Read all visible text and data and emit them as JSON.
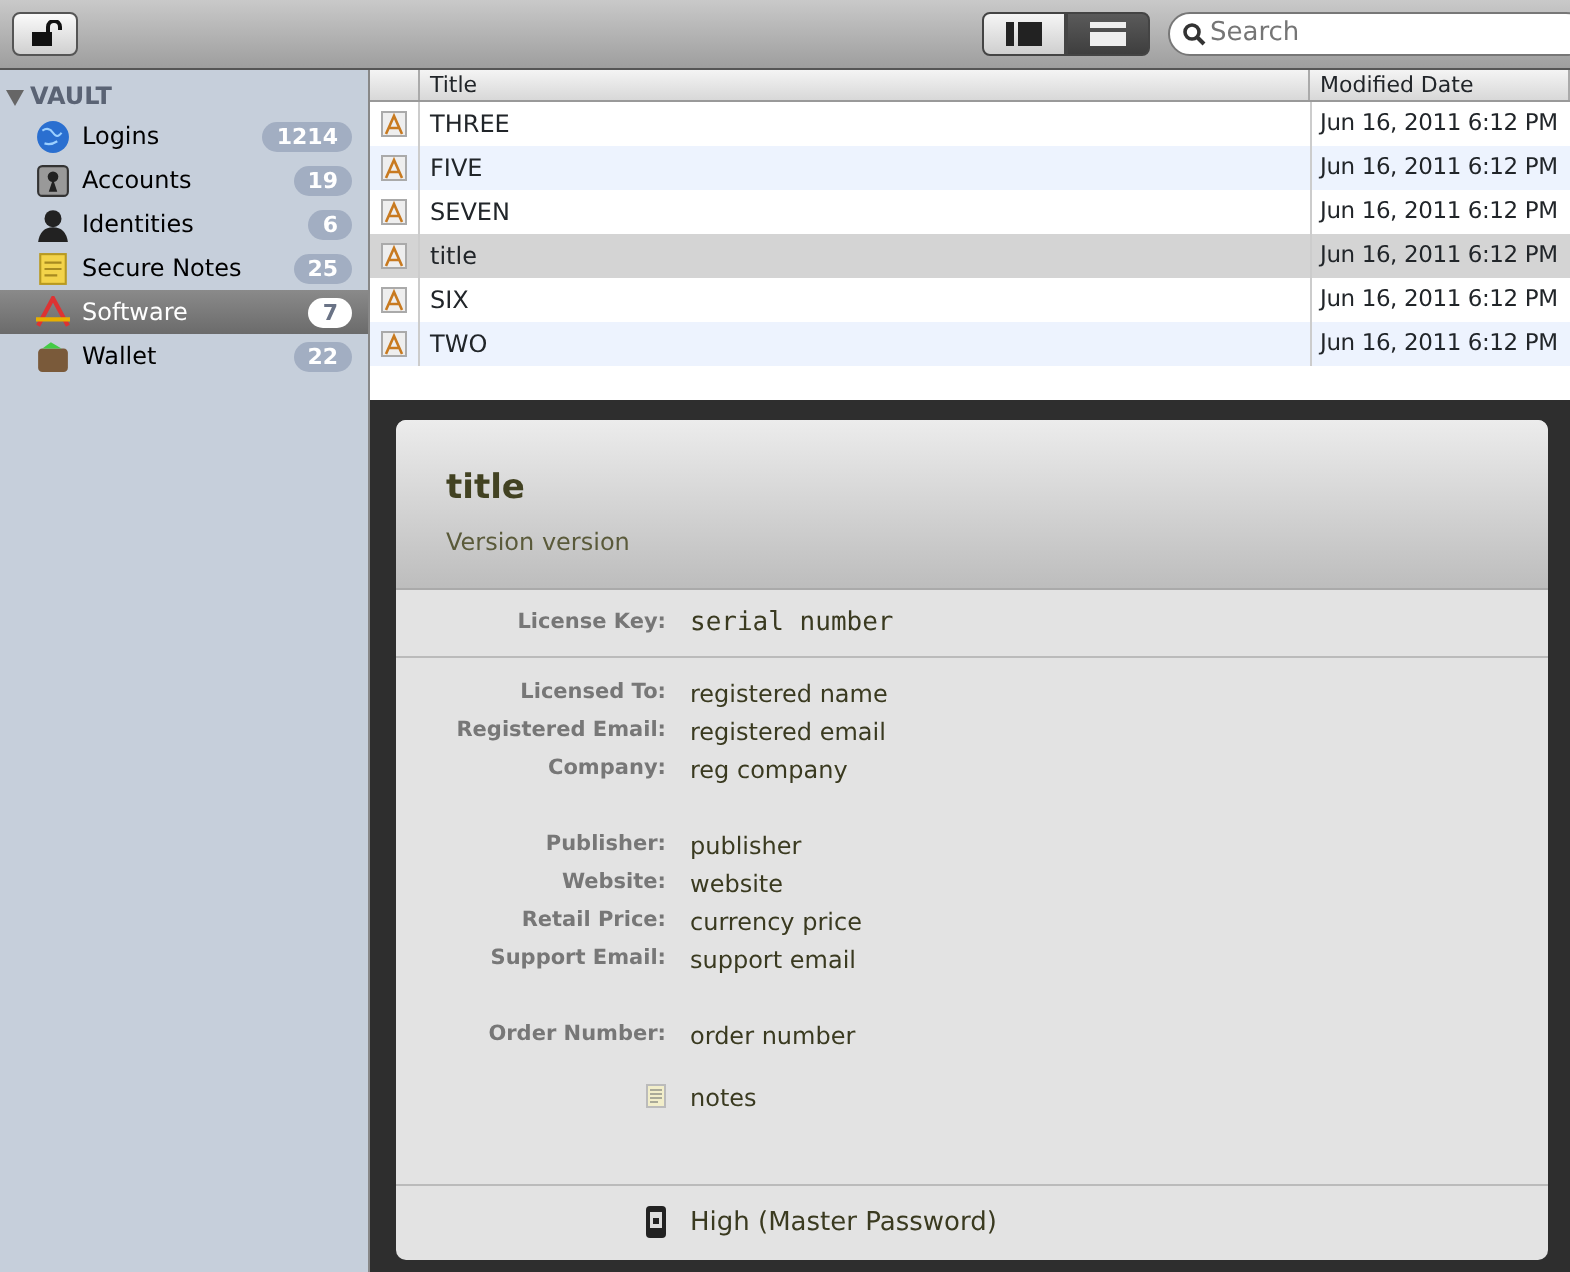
{
  "toolbar": {
    "view_toggle": [
      {
        "selected": false
      },
      {
        "selected": true
      }
    ],
    "search": {
      "placeholder": "Search"
    }
  },
  "sidebar": {
    "section": "VAULT",
    "expanded": true,
    "items": [
      {
        "label": "Logins",
        "count": "1214",
        "selected": false,
        "kind": "globe"
      },
      {
        "label": "Accounts",
        "count": "19",
        "selected": false,
        "kind": "keyhole"
      },
      {
        "label": "Identities",
        "count": "6",
        "selected": false,
        "kind": "person"
      },
      {
        "label": "Secure Notes",
        "count": "25",
        "selected": false,
        "kind": "note"
      },
      {
        "label": "Software",
        "count": "7",
        "selected": true,
        "kind": "tools"
      },
      {
        "label": "Wallet",
        "count": "22",
        "selected": false,
        "kind": "wallet"
      }
    ]
  },
  "table": {
    "columns": [
      "Title",
      "Modified Date"
    ],
    "rows": [
      {
        "title": "THREE",
        "modified": "Jun 16, 2011 6:12 PM",
        "selected": false
      },
      {
        "title": "FIVE",
        "modified": "Jun 16, 2011 6:12 PM",
        "selected": false
      },
      {
        "title": "SEVEN",
        "modified": "Jun 16, 2011 6:12 PM",
        "selected": false
      },
      {
        "title": "title",
        "modified": "Jun 16, 2011 6:12 PM",
        "selected": true
      },
      {
        "title": "SIX",
        "modified": "Jun 16, 2011 6:12 PM",
        "selected": false
      },
      {
        "title": "TWO",
        "modified": "Jun 16, 2011 6:12 PM",
        "selected": false
      }
    ]
  },
  "detail": {
    "title": "title",
    "subtitle": "Version version",
    "license": {
      "label": "License Key:",
      "value": "serial number"
    },
    "groups": [
      [
        {
          "label": "Licensed To:",
          "value": "registered name"
        },
        {
          "label": "Registered Email:",
          "value": "registered email"
        },
        {
          "label": "Company:",
          "value": "reg company"
        }
      ],
      [
        {
          "label": "Publisher:",
          "value": "publisher"
        },
        {
          "label": "Website:",
          "value": "website"
        },
        {
          "label": "Retail Price:",
          "value": "currency price"
        },
        {
          "label": "Support Email:",
          "value": "support email"
        }
      ],
      [
        {
          "label": "Order Number:",
          "value": "order number"
        }
      ]
    ],
    "notes": "notes",
    "security": "High (Master Password)"
  }
}
